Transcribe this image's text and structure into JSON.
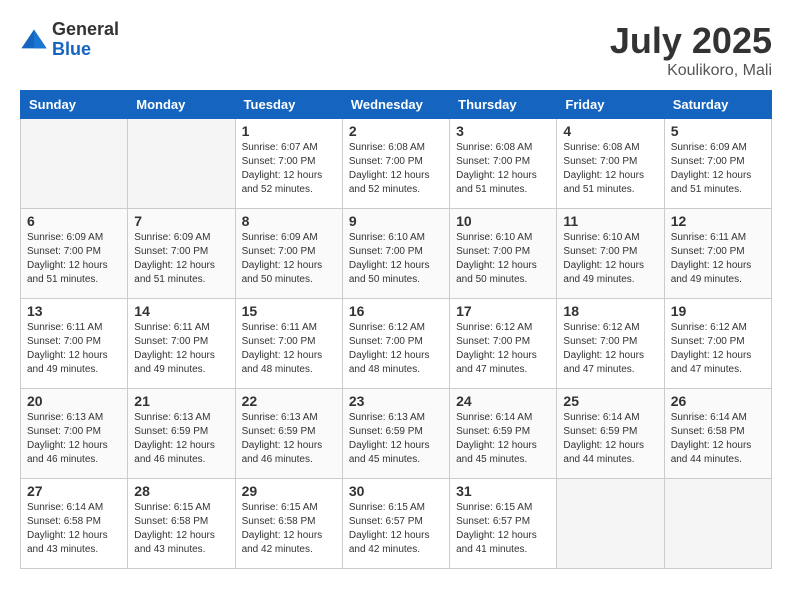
{
  "header": {
    "logo_general": "General",
    "logo_blue": "Blue",
    "month_year": "July 2025",
    "location": "Koulikoro, Mali"
  },
  "weekdays": [
    "Sunday",
    "Monday",
    "Tuesday",
    "Wednesday",
    "Thursday",
    "Friday",
    "Saturday"
  ],
  "weeks": [
    [
      {
        "day": "",
        "empty": true
      },
      {
        "day": "",
        "empty": true
      },
      {
        "day": "1",
        "sunrise": "6:07 AM",
        "sunset": "7:00 PM",
        "daylight": "12 hours and 52 minutes."
      },
      {
        "day": "2",
        "sunrise": "6:08 AM",
        "sunset": "7:00 PM",
        "daylight": "12 hours and 52 minutes."
      },
      {
        "day": "3",
        "sunrise": "6:08 AM",
        "sunset": "7:00 PM",
        "daylight": "12 hours and 51 minutes."
      },
      {
        "day": "4",
        "sunrise": "6:08 AM",
        "sunset": "7:00 PM",
        "daylight": "12 hours and 51 minutes."
      },
      {
        "day": "5",
        "sunrise": "6:09 AM",
        "sunset": "7:00 PM",
        "daylight": "12 hours and 51 minutes."
      }
    ],
    [
      {
        "day": "6",
        "sunrise": "6:09 AM",
        "sunset": "7:00 PM",
        "daylight": "12 hours and 51 minutes."
      },
      {
        "day": "7",
        "sunrise": "6:09 AM",
        "sunset": "7:00 PM",
        "daylight": "12 hours and 51 minutes."
      },
      {
        "day": "8",
        "sunrise": "6:09 AM",
        "sunset": "7:00 PM",
        "daylight": "12 hours and 50 minutes."
      },
      {
        "day": "9",
        "sunrise": "6:10 AM",
        "sunset": "7:00 PM",
        "daylight": "12 hours and 50 minutes."
      },
      {
        "day": "10",
        "sunrise": "6:10 AM",
        "sunset": "7:00 PM",
        "daylight": "12 hours and 50 minutes."
      },
      {
        "day": "11",
        "sunrise": "6:10 AM",
        "sunset": "7:00 PM",
        "daylight": "12 hours and 49 minutes."
      },
      {
        "day": "12",
        "sunrise": "6:11 AM",
        "sunset": "7:00 PM",
        "daylight": "12 hours and 49 minutes."
      }
    ],
    [
      {
        "day": "13",
        "sunrise": "6:11 AM",
        "sunset": "7:00 PM",
        "daylight": "12 hours and 49 minutes."
      },
      {
        "day": "14",
        "sunrise": "6:11 AM",
        "sunset": "7:00 PM",
        "daylight": "12 hours and 49 minutes."
      },
      {
        "day": "15",
        "sunrise": "6:11 AM",
        "sunset": "7:00 PM",
        "daylight": "12 hours and 48 minutes."
      },
      {
        "day": "16",
        "sunrise": "6:12 AM",
        "sunset": "7:00 PM",
        "daylight": "12 hours and 48 minutes."
      },
      {
        "day": "17",
        "sunrise": "6:12 AM",
        "sunset": "7:00 PM",
        "daylight": "12 hours and 47 minutes."
      },
      {
        "day": "18",
        "sunrise": "6:12 AM",
        "sunset": "7:00 PM",
        "daylight": "12 hours and 47 minutes."
      },
      {
        "day": "19",
        "sunrise": "6:12 AM",
        "sunset": "7:00 PM",
        "daylight": "12 hours and 47 minutes."
      }
    ],
    [
      {
        "day": "20",
        "sunrise": "6:13 AM",
        "sunset": "7:00 PM",
        "daylight": "12 hours and 46 minutes."
      },
      {
        "day": "21",
        "sunrise": "6:13 AM",
        "sunset": "6:59 PM",
        "daylight": "12 hours and 46 minutes."
      },
      {
        "day": "22",
        "sunrise": "6:13 AM",
        "sunset": "6:59 PM",
        "daylight": "12 hours and 46 minutes."
      },
      {
        "day": "23",
        "sunrise": "6:13 AM",
        "sunset": "6:59 PM",
        "daylight": "12 hours and 45 minutes."
      },
      {
        "day": "24",
        "sunrise": "6:14 AM",
        "sunset": "6:59 PM",
        "daylight": "12 hours and 45 minutes."
      },
      {
        "day": "25",
        "sunrise": "6:14 AM",
        "sunset": "6:59 PM",
        "daylight": "12 hours and 44 minutes."
      },
      {
        "day": "26",
        "sunrise": "6:14 AM",
        "sunset": "6:58 PM",
        "daylight": "12 hours and 44 minutes."
      }
    ],
    [
      {
        "day": "27",
        "sunrise": "6:14 AM",
        "sunset": "6:58 PM",
        "daylight": "12 hours and 43 minutes."
      },
      {
        "day": "28",
        "sunrise": "6:15 AM",
        "sunset": "6:58 PM",
        "daylight": "12 hours and 43 minutes."
      },
      {
        "day": "29",
        "sunrise": "6:15 AM",
        "sunset": "6:58 PM",
        "daylight": "12 hours and 42 minutes."
      },
      {
        "day": "30",
        "sunrise": "6:15 AM",
        "sunset": "6:57 PM",
        "daylight": "12 hours and 42 minutes."
      },
      {
        "day": "31",
        "sunrise": "6:15 AM",
        "sunset": "6:57 PM",
        "daylight": "12 hours and 41 minutes."
      },
      {
        "day": "",
        "empty": true
      },
      {
        "day": "",
        "empty": true
      }
    ]
  ]
}
